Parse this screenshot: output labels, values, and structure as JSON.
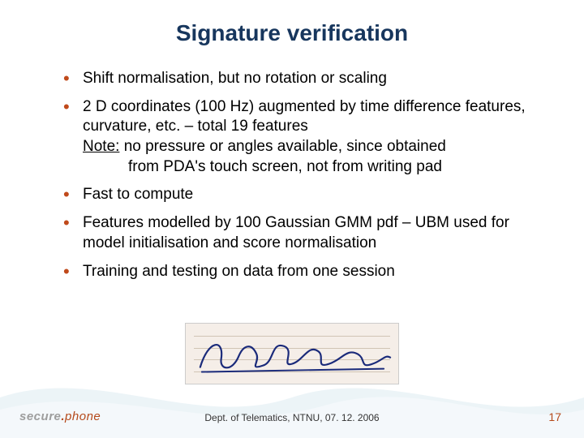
{
  "title": "Signature verification",
  "bullets": [
    {
      "text": "Shift normalisation, but no rotation or scaling"
    },
    {
      "text": "2 D coordinates (100 Hz) augmented by time difference features, curvature, etc. – total 19 features",
      "note_label": "Note:",
      "note_line1": " no pressure or angles available, since obtained",
      "note_line2": "from PDA's touch screen, not from writing pad"
    },
    {
      "text": "Fast to compute"
    },
    {
      "text": "Features modelled by 100 Gaussian GMM pdf – UBM used for model initialisation and score normalisation"
    },
    {
      "text": "Training and testing on data from one session"
    }
  ],
  "footer": {
    "text": "Dept. of Telematics, NTNU, 07. 12. 2006",
    "page": "17"
  },
  "logo": {
    "part1": "secure",
    "dot": ".",
    "part2": "phone"
  }
}
